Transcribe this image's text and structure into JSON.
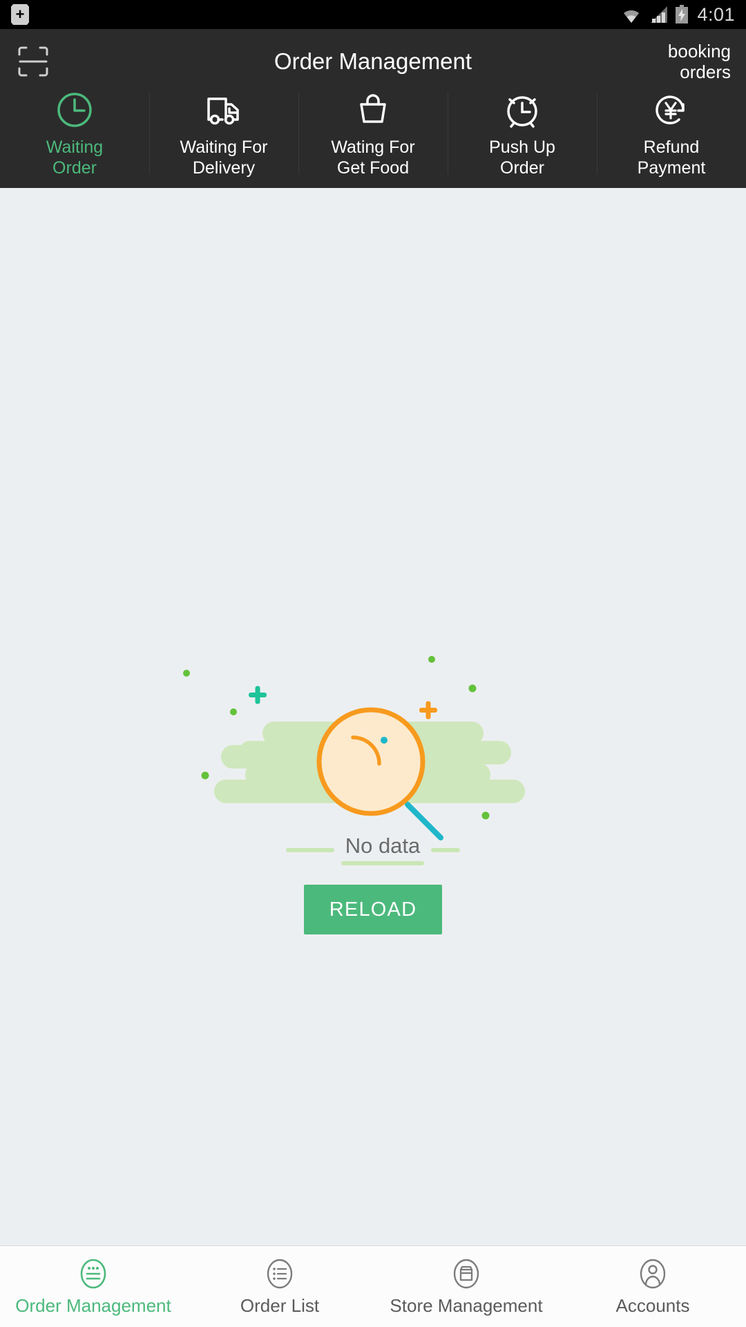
{
  "status_bar": {
    "plus_badge_icon": "plus-badge-icon",
    "wifi_icon": "wifi-icon",
    "signal_icon": "cellular-signal-icon",
    "battery_icon": "battery-charging-icon",
    "time": "4:01"
  },
  "app_bar": {
    "scan_icon": "scan-frame-icon",
    "title": "Order Management",
    "booking_orders_label": "booking\norders"
  },
  "tabs": [
    {
      "label": "Waiting\nOrder",
      "icon": "clock-icon",
      "active": true
    },
    {
      "label": "Waiting For\nDelivery",
      "icon": "delivery-truck-icon",
      "active": false
    },
    {
      "label": "Wating For\nGet Food",
      "icon": "shopping-bag-icon",
      "active": false
    },
    {
      "label": "Push Up\nOrder",
      "icon": "alarm-clock-icon",
      "active": false
    },
    {
      "label": "Refund\nPayment",
      "icon": "refund-yen-icon",
      "active": false
    }
  ],
  "empty_state": {
    "illustration_icon": "magnifying-glass-illustration",
    "message": "No data",
    "reload_label": "RELOAD"
  },
  "bottom_nav": [
    {
      "label": "Order Management",
      "icon": "order-management-icon",
      "active": true
    },
    {
      "label": "Order List",
      "icon": "order-list-icon",
      "active": false
    },
    {
      "label": "Store Management",
      "icon": "store-icon",
      "active": false
    },
    {
      "label": "Accounts",
      "icon": "account-person-icon",
      "active": false
    }
  ],
  "colors": {
    "accent_green": "#4cb97c",
    "app_bar_bg": "#2b2b2b",
    "content_bg": "#eceff1",
    "illustration_orange": "#f79a1e",
    "illustration_teal": "#1fb7c9",
    "illustration_bush": "#cfe7bc"
  }
}
